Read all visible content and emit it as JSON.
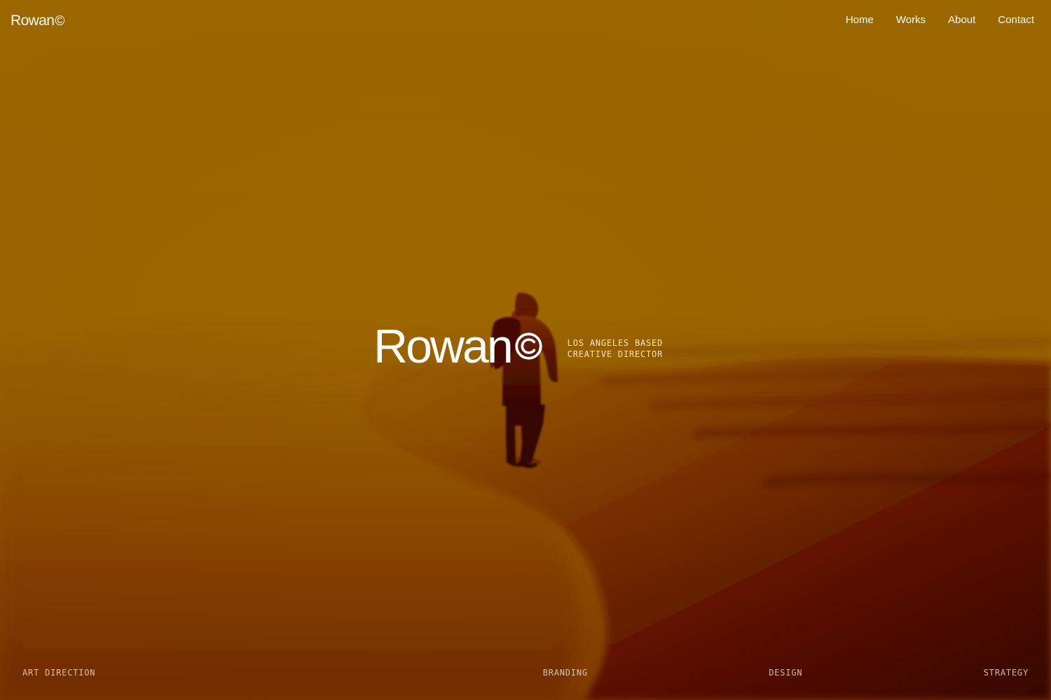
{
  "brand": {
    "name": "Rowan",
    "copyright_symbol": "©"
  },
  "nav": {
    "items": [
      "Home",
      "Works",
      "About",
      "Contact"
    ]
  },
  "hero": {
    "title": "Rowan",
    "tagline_lines": [
      "LOS ANGELES BASED",
      "CREATIVE DIRECTOR"
    ]
  },
  "services": [
    "ART DIRECTION",
    "BRANDING",
    "DESIGN",
    "STRATEGY"
  ],
  "colors": {
    "background_top": "#9b6a00",
    "background_mid": "#936200",
    "background_bottom_left": "#7a3200",
    "background_bottom_right": "#3a0000",
    "text": "#ffffff",
    "muted_text": "#f6e7cc"
  }
}
